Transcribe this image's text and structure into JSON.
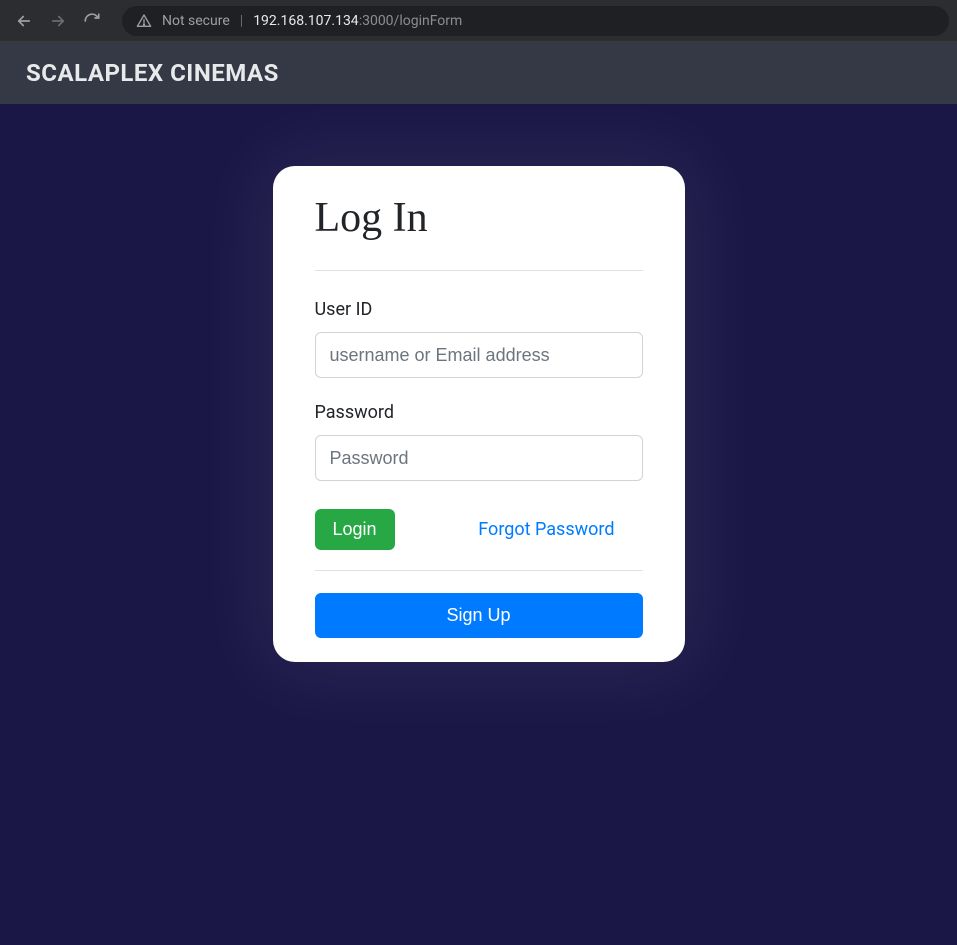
{
  "browser": {
    "not_secure_label": "Not secure",
    "url_host": "192.168.107.134",
    "url_rest": ":3000/loginForm"
  },
  "header": {
    "brand": "SCALAPLEX CINEMAS"
  },
  "login": {
    "title": "Log In",
    "user_label": "User ID",
    "user_placeholder": "username or Email address",
    "password_label": "Password",
    "password_placeholder": "Password",
    "login_button": "Login",
    "forgot_link": "Forgot Password",
    "signup_button": "Sign Up"
  }
}
